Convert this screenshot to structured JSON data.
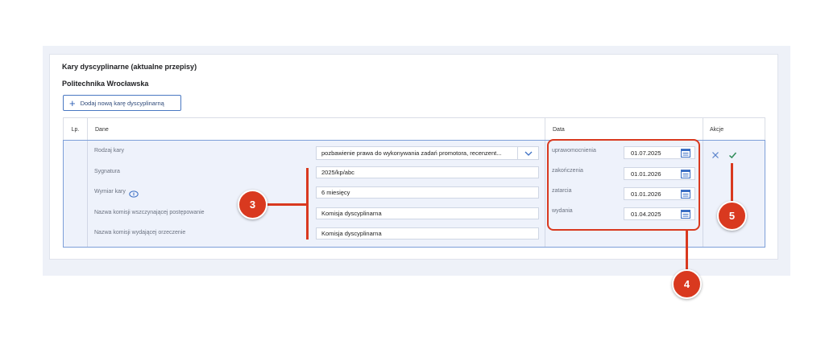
{
  "section": {
    "title": "Kary dyscyplinarne (aktualne przepisy)",
    "org": "Politechnika Wrocławska",
    "add_button": "Dodaj nową karę dyscyplinarną"
  },
  "table": {
    "headers": {
      "lp": "Lp.",
      "dane": "Dane",
      "data": "Data",
      "akcje": "Akcje"
    },
    "fields": [
      {
        "label": "Rodzaj kary",
        "value": "pozbawienie prawa do wykonywania zadań promotora, recenzent..."
      },
      {
        "label": "Sygnatura",
        "value": "2025/kp/abc"
      },
      {
        "label": "Wymiar kary",
        "value": "6 miesięcy"
      },
      {
        "label": "Nazwa komisji wszczynającej postępowanie",
        "value": "Komisja dyscyplinarna"
      },
      {
        "label": "Nazwa komisji wydającej orzeczenie",
        "value": "Komisja dyscyplinarna"
      }
    ],
    "dates": [
      {
        "label": "uprawomocnienia",
        "value": "01.07.2025"
      },
      {
        "label": "zakończenia",
        "value": "01.01.2026"
      },
      {
        "label": "zatarcia",
        "value": "01.01.2026"
      },
      {
        "label": "wydania",
        "value": "01.04.2025"
      }
    ]
  },
  "callouts": {
    "c3": "3",
    "c4": "4",
    "c5": "5"
  },
  "colors": {
    "accent": "#2f62b6",
    "callout": "#d9391f",
    "row_bg": "#eef2fb",
    "ok": "#2e8b57"
  },
  "icons": [
    "plus-icon",
    "chevron-down-icon",
    "info-icon",
    "calendar-icon",
    "close-icon",
    "check-icon"
  ]
}
